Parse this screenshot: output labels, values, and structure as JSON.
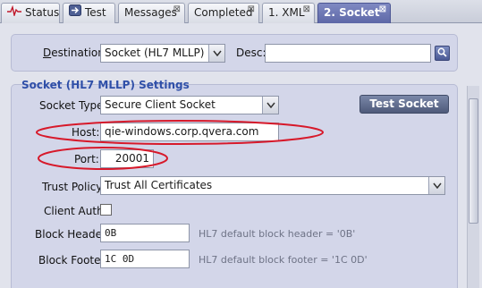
{
  "tabs": [
    {
      "label": "Status",
      "icon": "heartbeat-icon",
      "closable": false
    },
    {
      "label": "Test",
      "icon": "arrow-right-icon",
      "closable": false
    },
    {
      "label": "Messages",
      "closable": true
    },
    {
      "label": "Completed",
      "closable": true
    },
    {
      "label": "1. XML",
      "closable": true
    },
    {
      "label": "2. Socket",
      "closable": true,
      "active": true
    }
  ],
  "destination": {
    "label_prefix": "",
    "label_mnemonic": "D",
    "label_rest": "estination:",
    "value": "Socket (HL7 MLLP)",
    "desc_label": "Desc:",
    "desc_value": ""
  },
  "settings": {
    "title": "Socket (HL7 MLLP) Settings",
    "socket_type_label": "Socket Type:",
    "socket_type_value": "Secure Client Socket",
    "test_button": "Test Socket",
    "host_label": "Host:",
    "host_value": "qie-windows.corp.qvera.com",
    "port_label": "Port:",
    "port_value": "20001",
    "trust_policy_label": "Trust Policy:",
    "trust_policy_value": "Trust All Certificates",
    "client_auth_label": "Client Auth:",
    "client_auth_checked": false,
    "block_header_label": "Block Header:",
    "block_header_value": "0B",
    "block_header_hint": "HL7 default block header = '0B'",
    "block_footer_label": "Block Footer:",
    "block_footer_value": "1C 0D",
    "block_footer_hint": "HL7 default block footer = '1C 0D'"
  },
  "colors": {
    "accent": "#5c66a6",
    "highlight_ellipse": "#d7192a",
    "section_title": "#2f4fa8"
  }
}
